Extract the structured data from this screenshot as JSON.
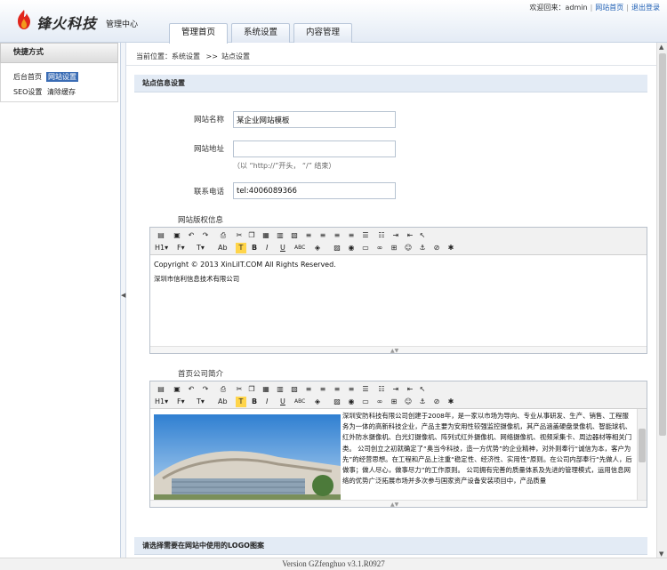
{
  "header": {
    "brand": "锋火科技",
    "subtitle": "管理中心",
    "welcome": "欢迎回来：",
    "user": "admin",
    "site_home_link": "网站首页",
    "logout_link": "退出登录",
    "tabs": [
      {
        "label": "管理首页",
        "active": true
      },
      {
        "label": "系统设置",
        "active": false
      },
      {
        "label": "内容管理",
        "active": false
      }
    ]
  },
  "sidebar": {
    "title": "快捷方式",
    "links": [
      {
        "label": "后台首页"
      },
      {
        "label": "网站设置"
      },
      {
        "label": "SEO设置"
      },
      {
        "label": "清除缓存"
      }
    ]
  },
  "breadcrumb": {
    "prefix": "当前位置：",
    "items": [
      "系统设置",
      "站点设置"
    ],
    "separator": ">>"
  },
  "form": {
    "section_title": "站点信息设置",
    "fields": [
      {
        "label": "网站名称",
        "value": "某企业网站模板"
      },
      {
        "label": "网站地址",
        "value": "",
        "hint": "（以 “http://”开头， “/” 结束）"
      },
      {
        "label": "联系电话",
        "value": "tel:4006089366"
      }
    ],
    "copyright": {
      "label": "网站版权信息",
      "lines": [
        "Copyright © 2013 XinLiIT.COM All Rights Reserved.",
        "深圳市信利信息技术有限公司"
      ]
    },
    "intro": {
      "label": "首页公司简介",
      "text": "深圳安防科技有限公司创建于2008年，是一家以市场为导向、专业从事研发、生产、销售、工程服务为一体的高新科技企业，产品主要为安用性较强监控摄像机，其产品涵盖硬盘录像机、智能球机、红外防水摄像机、白光灯摄像机、阵列式红外摄像机、网络摄像机、视频采集卡、周边器材等相关门类。 公司创立之初就确定了“奥当今科技，造一方优势”的企业精神，对外则奉行“诚信为本，客户为先”的经营思想。在工程和产品上注重“稳定性、经济性、实用性”原则。在公司内部奉行“先做人，后做事；做人尽心，做事尽力”的工作原则。 公司拥有完善的质量体系及先进的管理模式，运用信息网络的优势广泛拓展市场并多次参与国家资产设备安装项目中，产品质量"
    },
    "logo_section_title": "请选择需要在网站中使用的LOGO图案"
  },
  "toolbar_row1": [
    "source",
    "preview",
    "undo",
    "redo",
    "print",
    "cut",
    "copy",
    "paste",
    "paste-text",
    "paste-word",
    "justify-left",
    "justify-center",
    "justify-right",
    "justify-full",
    "ordered-list",
    "unordered-list",
    "indent",
    "outdent",
    "select"
  ],
  "toolbar_row2_labels": {
    "heading": "H1",
    "font": "F",
    "size": "T",
    "spell": "Ab",
    "hilite": "T",
    "bold": "B",
    "italic": "I",
    "underline": "U",
    "strike": "ABC"
  },
  "footer": {
    "version": "Version GZfenghuo v3.1.R0927"
  }
}
